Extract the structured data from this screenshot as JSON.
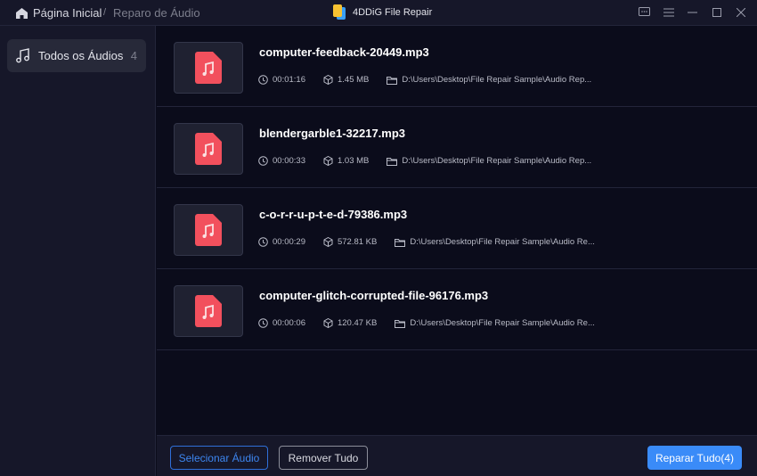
{
  "header": {
    "home": "Página Inicial",
    "separator": "/",
    "current": "Reparo de Áudio",
    "app_title": "4DDiG File Repair"
  },
  "sidebar": {
    "items": [
      {
        "label": "Todos os Áudios",
        "count": "4"
      }
    ]
  },
  "files": [
    {
      "name": "computer-feedback-20449.mp3",
      "duration": "00:01:16",
      "size": "1.45 MB",
      "path": "D:\\Users\\Desktop\\File Repair Sample\\Audio Rep..."
    },
    {
      "name": "blendergarble1-32217.mp3",
      "duration": "00:00:33",
      "size": "1.03 MB",
      "path": "D:\\Users\\Desktop\\File Repair Sample\\Audio Rep..."
    },
    {
      "name": "c-o-r-r-u-p-t-e-d-79386.mp3",
      "duration": "00:00:29",
      "size": "572.81 KB",
      "path": "D:\\Users\\Desktop\\File Repair Sample\\Audio Re..."
    },
    {
      "name": "computer-glitch-corrupted-file-96176.mp3",
      "duration": "00:00:06",
      "size": "120.47 KB",
      "path": "D:\\Users\\Desktop\\File Repair Sample\\Audio Re..."
    }
  ],
  "footer": {
    "select": "Selecionar Áudio",
    "remove": "Remover Tudo",
    "repair": "Reparar Tudo(4)"
  },
  "colors": {
    "accent": "#3a8bf8",
    "file_icon": "#f2505d"
  }
}
